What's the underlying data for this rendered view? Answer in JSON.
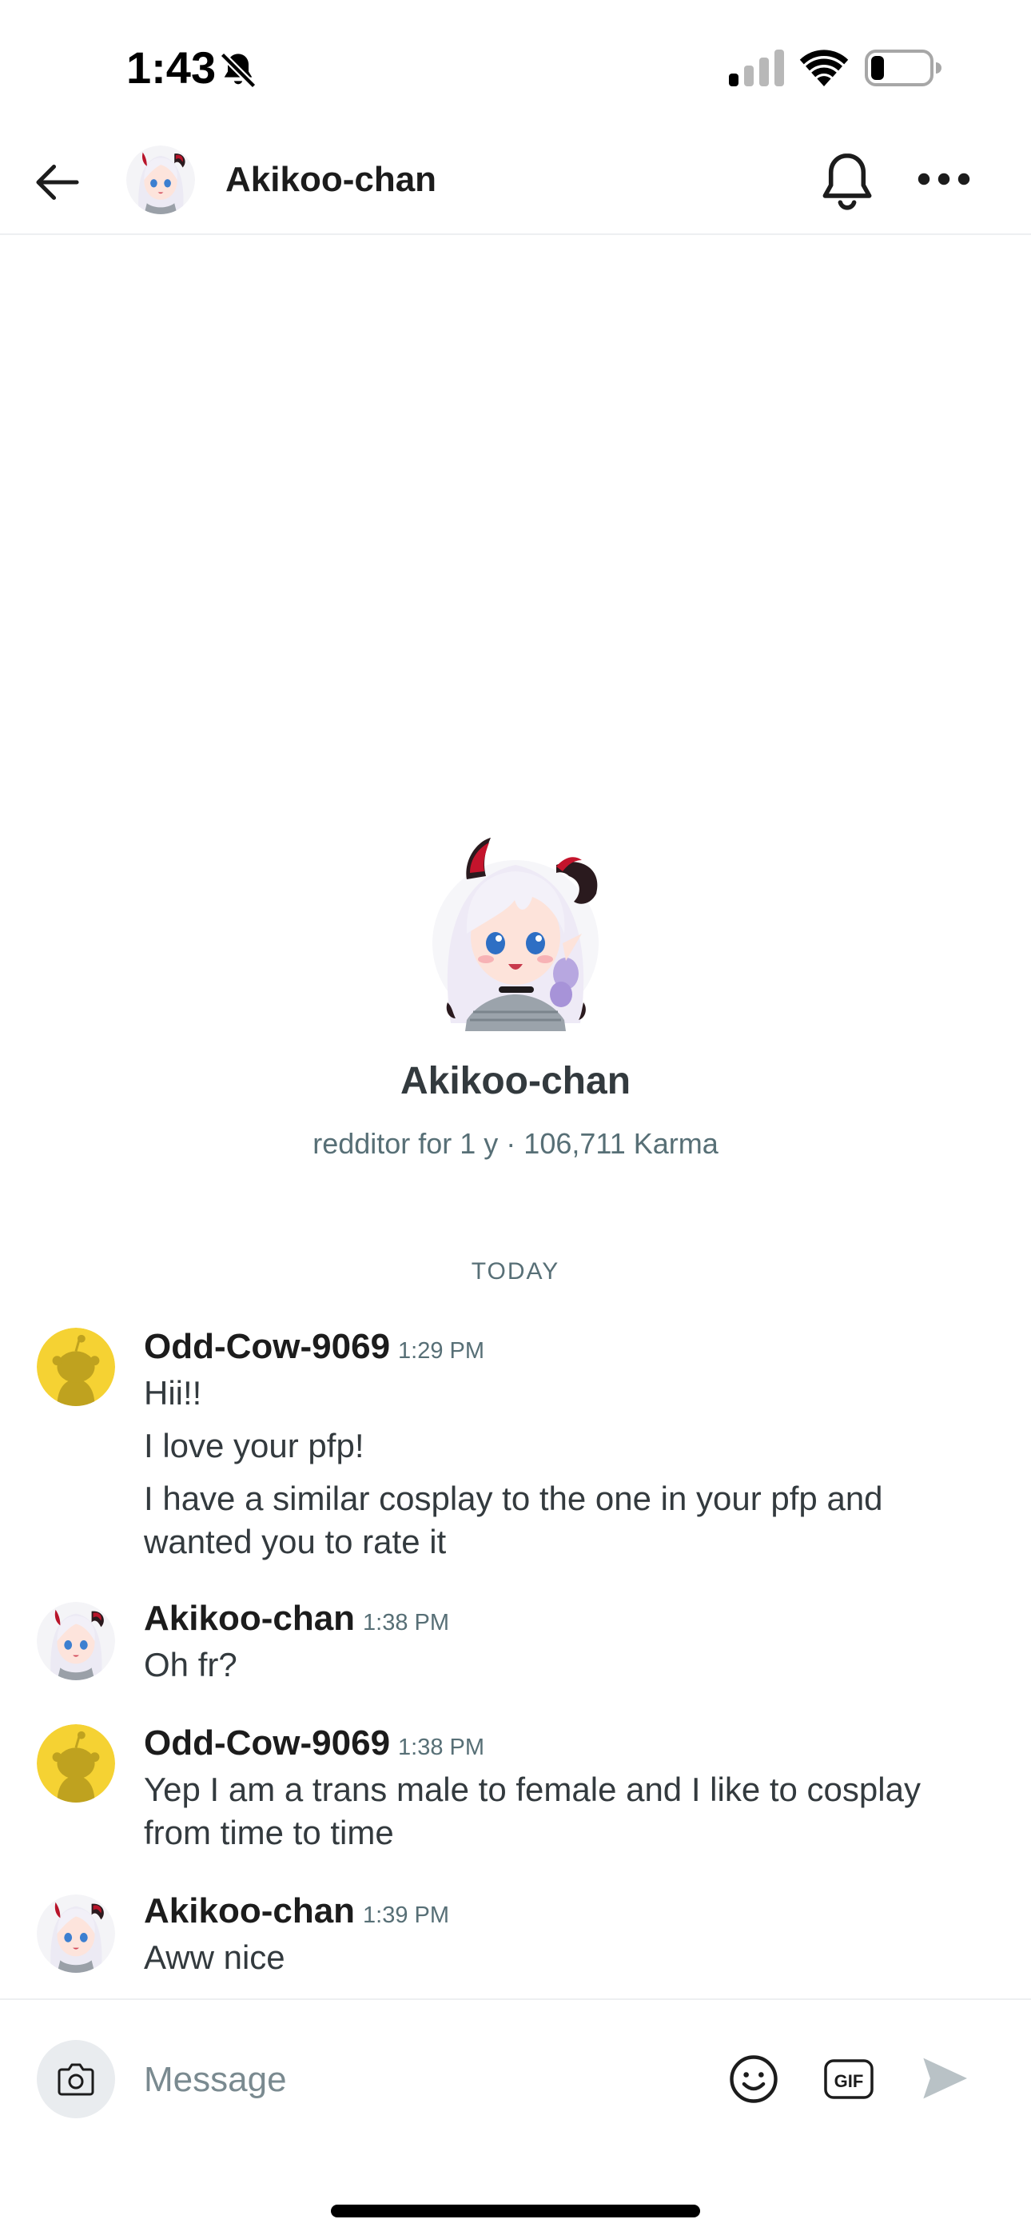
{
  "status_bar": {
    "time": "1:43",
    "icons": [
      "bell-off-icon",
      "cellular-signal-icon",
      "wifi-icon",
      "battery-icon"
    ]
  },
  "header": {
    "title": "Akikoo-chan",
    "icons": [
      "back-arrow-icon",
      "bell-icon",
      "more-dots-icon"
    ]
  },
  "profile": {
    "name": "Akikoo-chan",
    "meta": "redditor for 1 y · 106,711 Karma"
  },
  "date_separator": "TODAY",
  "messages": [
    {
      "author": "Odd-Cow-9069",
      "time": "1:29 PM",
      "avatar": "snoo-avatar",
      "lines": [
        "Hii!!",
        "I love your pfp!",
        "I have a similar cosplay to the one in your pfp and wanted you to rate it"
      ]
    },
    {
      "author": "Akikoo-chan",
      "time": "1:38 PM",
      "avatar": "anime-avatar",
      "lines": [
        "Oh fr?"
      ]
    },
    {
      "author": "Odd-Cow-9069",
      "time": "1:38 PM",
      "avatar": "snoo-avatar",
      "lines": [
        "Yep I am a trans male to female and I like to cosplay from time to time"
      ]
    },
    {
      "author": "Akikoo-chan",
      "time": "1:39 PM",
      "avatar": "anime-avatar",
      "lines": [
        "Aww nice"
      ]
    }
  ],
  "composer": {
    "placeholder": "Message",
    "gif_label": "GIF",
    "icons": [
      "camera-icon",
      "emoji-icon",
      "gif-icon",
      "send-icon"
    ]
  },
  "colors": {
    "snoo_yellow": "#f5d233",
    "secondary_text": "#576f76",
    "divider": "#edeff1",
    "horn_red": "#b8142a",
    "hair_lavender": "#eeeaf6"
  }
}
